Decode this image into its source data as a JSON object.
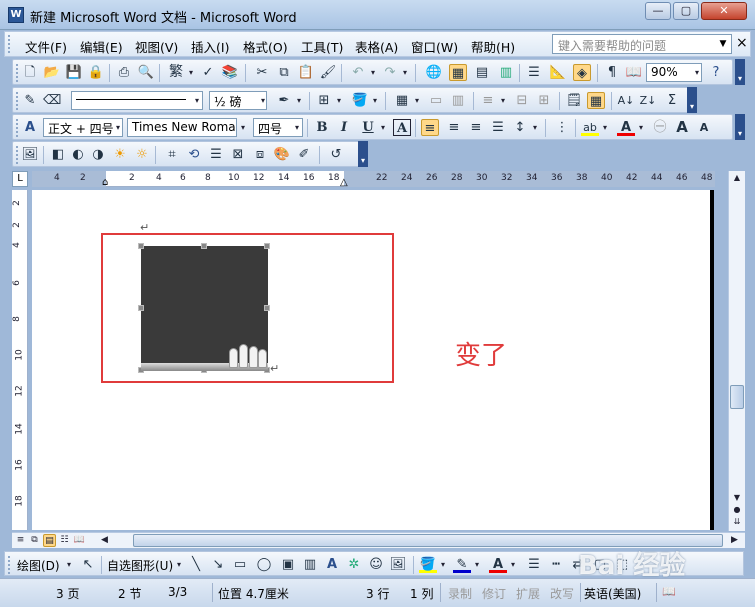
{
  "window": {
    "title": "新建 Microsoft Word 文档 - Microsoft Word",
    "app_icon": "W",
    "minimize_icon": "—",
    "maximize_icon": "▢",
    "close_icon": "✕"
  },
  "menubar": {
    "items": [
      "文件(F)",
      "编辑(E)",
      "视图(V)",
      "插入(I)",
      "格式(O)",
      "工具(T)",
      "表格(A)",
      "窗口(W)",
      "帮助(H)"
    ],
    "help_placeholder": "键入需要帮助的问题",
    "dropdown_icon": "▼",
    "close_doc_icon": "×"
  },
  "standard_toolbar": {
    "icons": [
      "new-doc",
      "open",
      "save",
      "permission",
      "print",
      "print-preview",
      "spelling",
      "research",
      "cut",
      "copy",
      "paste",
      "format-painter",
      "undo",
      "redo",
      "hyperlink",
      "tables-borders",
      "insert-table",
      "insert-excel",
      "columns",
      "drawing",
      "document-map",
      "show-hide",
      "read"
    ],
    "traditional_char": "繁",
    "zoom": "90%",
    "help_icon": "?"
  },
  "tables_toolbar": {
    "line_weight": "½ 磅",
    "icons": [
      "draw-table",
      "eraser",
      "line-style",
      "border-color",
      "outside-border",
      "shading",
      "insert-table",
      "merge-cells",
      "split-cells",
      "align",
      "distribute-rows",
      "distribute-cols",
      "autoformat",
      "show-gridlines",
      "sort-asc",
      "sort-desc",
      "autosum"
    ]
  },
  "formatting_toolbar": {
    "style": "正文 + 四号",
    "font": "Times New Roman",
    "size": "四号",
    "bold": "B",
    "italic": "I",
    "underline": "U",
    "char_border": "A",
    "highlight_letter": "ab",
    "font_color_letter": "A",
    "grow_font": "A",
    "shrink_font": "A"
  },
  "picture_toolbar": {
    "icons": [
      "insert-picture",
      "color",
      "more-contrast",
      "less-contrast",
      "more-brightness",
      "less-brightness",
      "crop",
      "rotate-left",
      "line-style",
      "compress",
      "text-wrapping",
      "format-picture",
      "set-transparent-color",
      "reset-picture"
    ]
  },
  "ruler": {
    "corner": "L",
    "left_ticks": [
      "4",
      "2"
    ],
    "main_ticks": [
      "2",
      "4",
      "6",
      "8",
      "10",
      "12",
      "14",
      "16",
      "18"
    ],
    "right_ticks": [
      "22",
      "24",
      "26",
      "28",
      "30",
      "32",
      "34",
      "36",
      "38",
      "40",
      "42",
      "44",
      "46",
      "48"
    ],
    "vertical_ticks": [
      "2",
      "2",
      "4",
      "6",
      "8",
      "10",
      "12",
      "14",
      "16",
      "18"
    ]
  },
  "document": {
    "paragraph_mark": "↵",
    "annotation": "变了"
  },
  "drawing_toolbar": {
    "draw_label": "绘图(D)",
    "autoshapes_label": "自选图形(U)",
    "icons": [
      "select-objects",
      "line",
      "arrow",
      "rectangle",
      "oval",
      "text-box",
      "vertical-text-box",
      "wordart",
      "diagram",
      "clip-art",
      "insert-picture",
      "fill-color",
      "line-color",
      "font-color",
      "line-style",
      "dash-style",
      "arrow-style",
      "shadow",
      "3d-style"
    ]
  },
  "statusbar": {
    "page": "3 页",
    "section": "2 节",
    "page_of": "3/3",
    "position": "位置 4.7厘米",
    "line": "3 行",
    "column": "1 列",
    "rec": "录制",
    "trk": "修订",
    "ext": "扩展",
    "ovr": "改写",
    "language": "英语(美国)"
  },
  "watermark": "Bai 经验"
}
